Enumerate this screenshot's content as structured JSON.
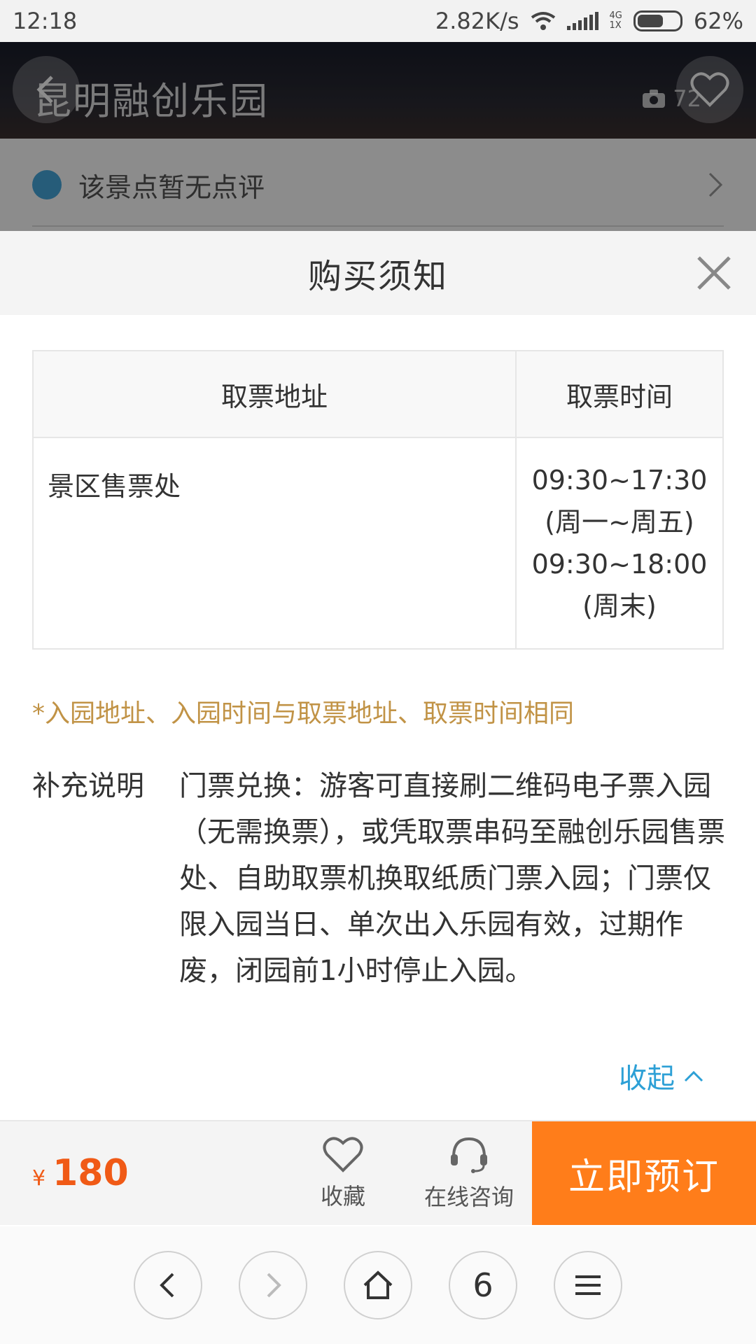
{
  "status_bar": {
    "time": "12:18",
    "net_speed": "2.82K/s",
    "net_type_top": "4G",
    "net_type_bottom": "1X",
    "battery": "62%",
    "battery_level": 0.62
  },
  "background_page": {
    "title": "昆明融创乐园",
    "photo_count": "72",
    "review_text": "该景点暂无点评"
  },
  "sheet": {
    "title": "购买须知",
    "table": {
      "headers": [
        "取票地址",
        "取票时间"
      ],
      "address": "景区售票处",
      "hours": [
        "09:30~17:30",
        "(周一~周五)",
        "09:30~18:00",
        "(周末)"
      ]
    },
    "note": "*入园地址、入园时间与取票地址、取票时间相同",
    "supplement_label": "补充说明",
    "supplement_text": "门票兑换：游客可直接刷二维码电子票入园（无需换票），或凭取票串码至融创乐园售票处、自助取票机换取纸质门票入园；门票仅限入园当日、单次出入乐园有效，过期作废，闭园前1小时停止入园。",
    "collapse_label": "收起"
  },
  "action_bar": {
    "currency": "¥",
    "price": "180",
    "favorite_label": "收藏",
    "consult_label": "在线咨询",
    "book_label": "立即预订"
  },
  "browser_nav": {
    "tab_count": "6"
  },
  "colors": {
    "accent_orange": "#ff7d1a",
    "price_color": "#f05a16",
    "note_color": "#c19346",
    "link_blue": "#2da0d6"
  }
}
